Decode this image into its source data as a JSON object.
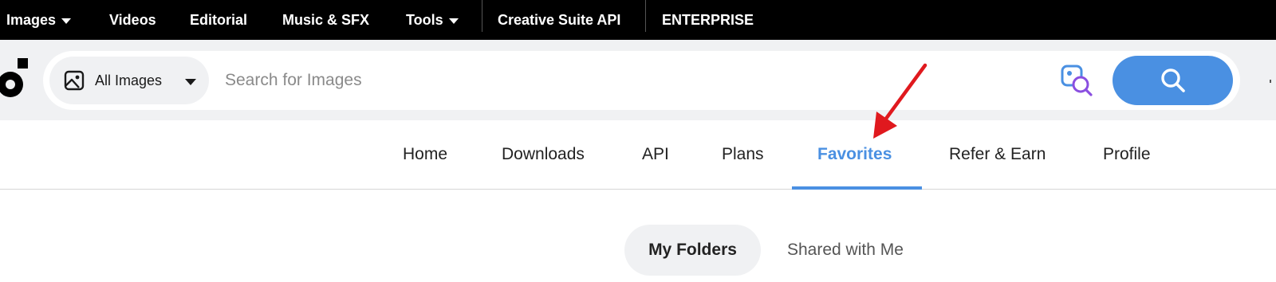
{
  "topnav": {
    "items": [
      {
        "label": "Images",
        "dropdown": true
      },
      {
        "label": "Videos",
        "dropdown": false
      },
      {
        "label": "Editorial",
        "dropdown": false
      },
      {
        "label": "Music & SFX",
        "dropdown": false
      },
      {
        "label": "Tools",
        "dropdown": true
      },
      {
        "label": "Creative Suite API",
        "dropdown": false
      },
      {
        "label": "ENTERPRISE",
        "dropdown": false
      }
    ]
  },
  "search": {
    "filter_label": "All Images",
    "placeholder": "Search for Images",
    "value": ""
  },
  "subnav": {
    "tabs": [
      {
        "label": "Home",
        "active": false
      },
      {
        "label": "Downloads",
        "active": false
      },
      {
        "label": "API",
        "active": false
      },
      {
        "label": "Plans",
        "active": false
      },
      {
        "label": "Favorites",
        "active": true
      },
      {
        "label": "Refer & Earn",
        "active": false
      },
      {
        "label": "Profile",
        "active": false
      }
    ]
  },
  "folders": {
    "my_folders": "My Folders",
    "shared_with_me": "Shared with Me",
    "selected": "My Folders"
  },
  "colors": {
    "accent": "#4a90e2",
    "topnav_bg": "#000000",
    "band_bg": "#f0f1f3",
    "annotation": "#e0191e",
    "visual_search_primary": "#4a90e2",
    "visual_search_secondary": "#8a4fe0"
  },
  "icons": {
    "filter": "image-icon",
    "visual_search": "visual-search-icon",
    "search_button": "search-icon"
  }
}
